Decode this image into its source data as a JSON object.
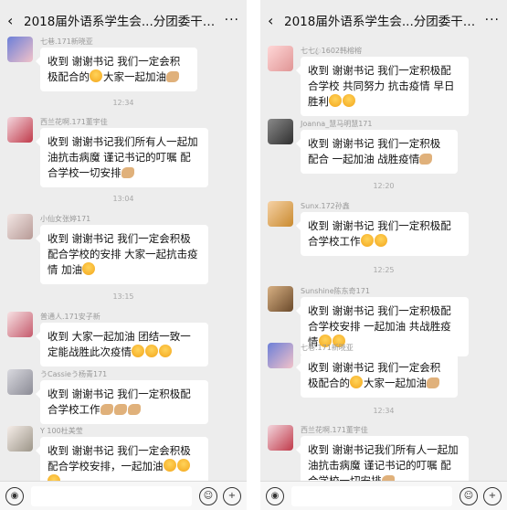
{
  "left": {
    "title": "2018届外语系学生会...分团委干部群(26)",
    "status_fragment": "…",
    "messages": [
      {
        "name": "七巷.171新晓亚",
        "text": "收到 谢谢书记 我们一定会积极配合的",
        "text2": "大家一起加油"
      },
      {
        "time": "12:34"
      },
      {
        "name": "西兰花啊.171董宇佳",
        "text": "收到 谢谢书记我们所有人一起加油抗击病魔 谨记书记的叮嘱 配合学校一切安排"
      },
      {
        "time": "13:04"
      },
      {
        "name": "小仙女张婷171",
        "text": "收到 谢谢书记 我们一定会积极配合学校的安排 大家一起抗击疫情 加油"
      },
      {
        "time": "13:15"
      },
      {
        "name": "普通人.171安子新",
        "text": "收到  大家一起加油 团结一致一定能战胜此次疫情"
      },
      {
        "name": "うCassieう杨青171",
        "text": "收到 谢谢书记 我们一定积极配合学校工作"
      },
      {
        "name": "Y 100杜美莹",
        "text": "收到 谢谢书记 我们一定会积极配合学校安排，一起加油"
      }
    ]
  },
  "right": {
    "title": "2018届外语系学生会...分团委干部群(26)",
    "messages": [
      {
        "name": "七七ꦿ1602韩榕榕",
        "text": "收到 谢谢书记 我们一定积极配合学校 共同努力 抗击疫情 早日胜利"
      },
      {
        "name": "Joanna_慧马明慧171",
        "text": "收到 谢谢书记 我们一定积极配合 一起加油 战胜疫情"
      },
      {
        "time": "12:20"
      },
      {
        "name": "Sunx.172孙鑫",
        "text": "收到 谢谢书记 我们一定积极配合学校工作"
      },
      {
        "time": "12:25"
      },
      {
        "name": "Sunshine陈东奇171",
        "text": "收到 谢谢书记 我们一定积极配合学校安排 一起加油 共战胜疫情"
      },
      {
        "name": "七巷.171新晓亚",
        "text": "收到 谢谢书记 我们一定会积极配合的",
        "text2": "大家一起加油"
      },
      {
        "time": "12:34"
      },
      {
        "name": "西兰花啊.171董宇佳",
        "text": "收到 谢谢书记我们所有人一起加油抗击病魔 谨记书记的叮嘱 配合学校一切安排"
      }
    ]
  },
  "icons": {
    "back": "‹",
    "more": "···",
    "voice": "◉",
    "emoji": "☺",
    "plus": "+"
  },
  "colors": {
    "chat_bg": "#ededed",
    "bubble": "#ffffff",
    "meta_text": "#999999"
  }
}
